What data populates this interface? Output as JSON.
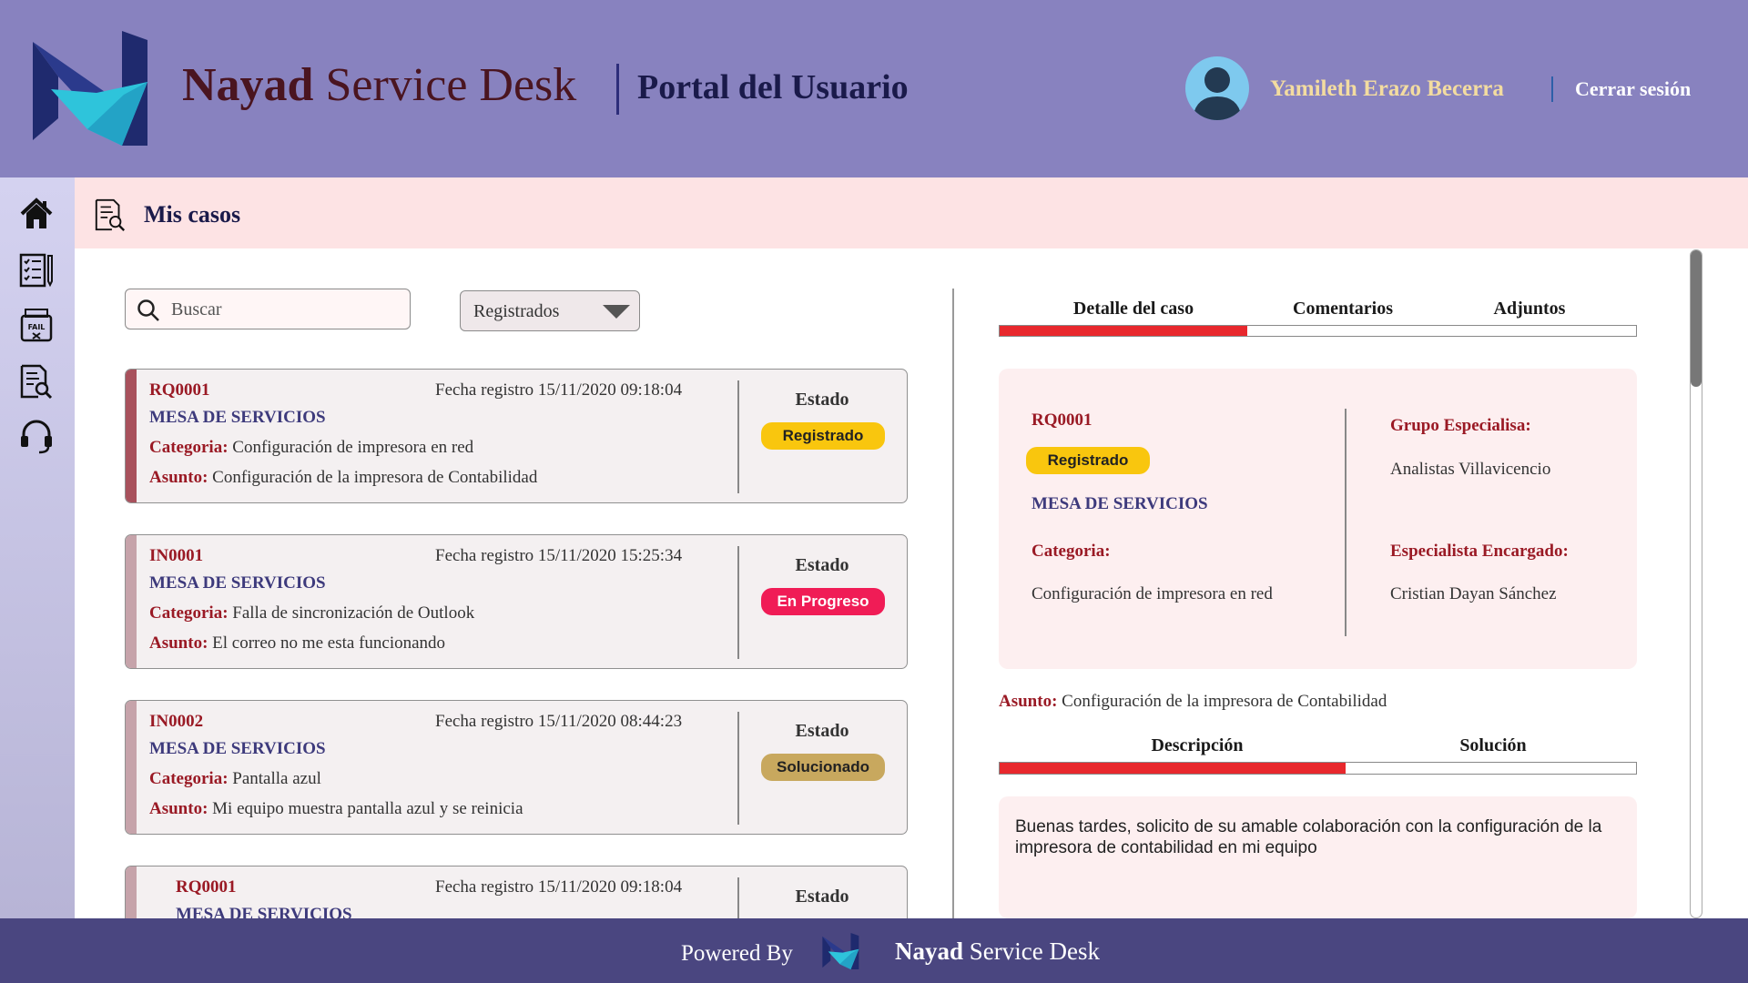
{
  "header": {
    "brand_bold": "Nayad",
    "brand_rest": " Service Desk",
    "portal_title": "Portal del Usuario",
    "user_name": "Yamileth Erazo Becerra",
    "logout": "Cerrar sesión"
  },
  "sidebar": {
    "items": [
      {
        "icon": "home-icon"
      },
      {
        "icon": "checklist-icon"
      },
      {
        "icon": "fail-report-icon"
      },
      {
        "icon": "document-search-icon"
      },
      {
        "icon": "headset-icon"
      }
    ]
  },
  "page": {
    "title": "Mis casos",
    "title_icon": "document-search-icon"
  },
  "search": {
    "placeholder": "Buscar",
    "icon": "search-icon"
  },
  "filter": {
    "selected": "Registrados"
  },
  "colors": {
    "registrado": "#f9c60e",
    "en_progreso": "#f01c56",
    "solucionado": "#c8a85e",
    "accent_red": "#e8282d",
    "header_bg": "#8882bf",
    "footer_bg": "#4a4680"
  },
  "cases": [
    {
      "id": "RQ0001",
      "fecha": "Fecha registro 15/11/2020 09:18:04",
      "grupo": "MESA DE SERVICIOS",
      "categoria_label": "Categoria:",
      "categoria": " Configuración de impresora en red",
      "asunto_label": "Asunto:",
      "asunto": " Configuración de la impresora de Contabilidad",
      "estado_label": "Estado",
      "estado": "Registrado"
    },
    {
      "id": "IN0001",
      "fecha": "Fecha registro 15/11/2020 15:25:34",
      "grupo": "MESA DE SERVICIOS",
      "categoria_label": "Categoria:",
      "categoria": " Falla de sincronización de Outlook",
      "asunto_label": "Asunto:",
      "asunto": " El correo no me esta funcionando",
      "estado_label": "Estado",
      "estado": "En Progreso"
    },
    {
      "id": "IN0002",
      "fecha": "Fecha registro 15/11/2020 08:44:23",
      "grupo": "MESA DE SERVICIOS",
      "categoria_label": "Categoria:",
      "categoria": " Pantalla azul",
      "asunto_label": "Asunto:",
      "asunto": " Mi equipo muestra pantalla azul y se reinicia",
      "estado_label": "Estado",
      "estado": "Solucionado"
    },
    {
      "id": "RQ0001",
      "fecha": "Fecha registro 15/11/2020 09:18:04",
      "grupo": "MESA DE SERVICIOS",
      "estado_label": "Estado"
    }
  ],
  "detail": {
    "tabs": [
      "Detalle del caso",
      "Comentarios",
      "Adjuntos"
    ],
    "id": "RQ0001",
    "estado": "Registrado",
    "grupo": "MESA DE SERVICIOS",
    "categoria_label": "Categoria:",
    "categoria": "Configuración de impresora en red",
    "grupo_especialista_label": "Grupo Especialisa:",
    "grupo_especialista": "Analistas Villavicencio",
    "especialista_label": "Especialista Encargado:",
    "especialista": "Cristian Dayan Sánchez",
    "asunto_label": "Asunto:",
    "asunto": " Configuración de la impresora de Contabilidad",
    "subtabs": [
      "Descripción",
      "Solución"
    ],
    "descripcion": "Buenas tardes, solicito de su amable colaboración con la configuración de la impresora de contabilidad en mi equipo"
  },
  "footer": {
    "powered_by": "Powered By",
    "brand_bold": "Nayad",
    "brand_rest": " Service Desk"
  }
}
